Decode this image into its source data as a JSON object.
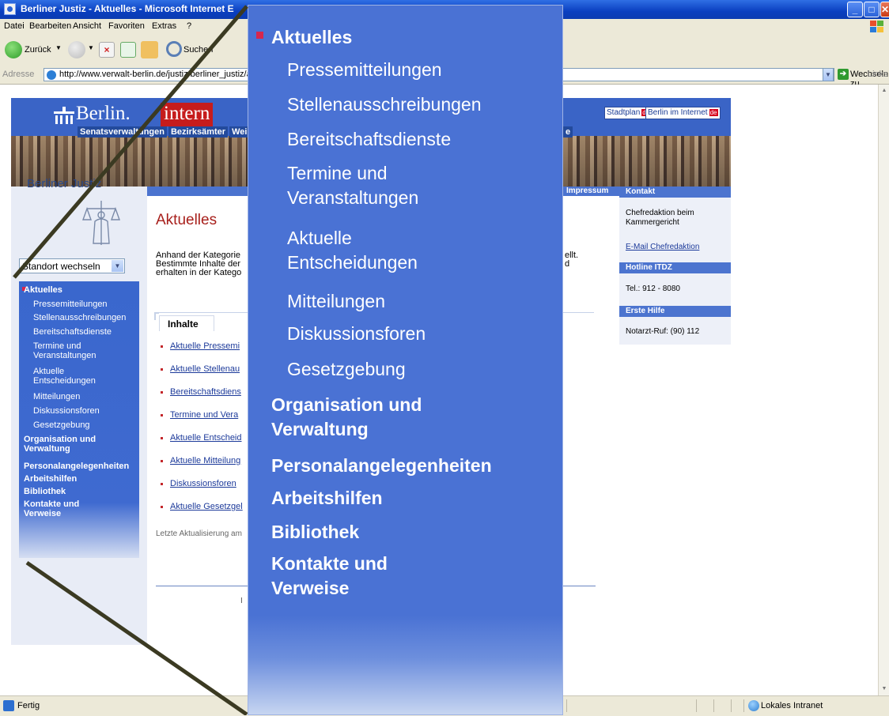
{
  "window": {
    "title": "Berliner Justiz - Aktuelles - Microsoft Internet E"
  },
  "menu": {
    "items": [
      "Datei",
      "Bearbeiten",
      "Ansicht",
      "Favoriten",
      "Extras",
      "?"
    ]
  },
  "toolbar": {
    "back_label": "Zurück",
    "search_label": "Suchen"
  },
  "address": {
    "label": "Adresse",
    "url": "http://www.verwalt-berlin.de/justiz/berliner_justiz/a",
    "go_label": "Wechseln zu",
    "links_label": "Links"
  },
  "header": {
    "logo_part1": "Berlin.",
    "logo_part2": "intern",
    "nav_items": [
      "Senatsverwaltungen",
      "Bezirksämter",
      "Wei"
    ],
    "nav_tail": "e",
    "stadtplan_label": "Stadtplan",
    "berlin_internet_label": "Berlin im Internet",
    "de_badge": "de"
  },
  "sidebar": {
    "section_title": "Berliner Justiz",
    "standort_label": "Standort wechseln",
    "items": [
      {
        "label": "Aktuelles",
        "level": "top",
        "active": true
      },
      {
        "label": "Pressemitteilungen",
        "level": "sub"
      },
      {
        "label": "Stellenausschreibungen",
        "level": "sub"
      },
      {
        "label": "Bereitschaftsdienste",
        "level": "sub"
      },
      {
        "label": "Termine und\nVeranstaltungen",
        "level": "sub"
      },
      {
        "label": "Aktuelle\nEntscheidungen",
        "level": "sub"
      },
      {
        "label": "Mitteilungen",
        "level": "sub"
      },
      {
        "label": "Diskussionsforen",
        "level": "sub"
      },
      {
        "label": "Gesetzgebung",
        "level": "sub"
      },
      {
        "label": "Organisation und\nVerwaltung",
        "level": "top"
      },
      {
        "label": "Personalangelegenheiten",
        "level": "top"
      },
      {
        "label": "Arbeitshilfen",
        "level": "top"
      },
      {
        "label": "Bibliothek",
        "level": "top"
      },
      {
        "label": "Kontakte und\nVerweise",
        "level": "top"
      }
    ]
  },
  "main": {
    "heading": "Aktuelles",
    "intro_lines": "Anhand der Kategorie\nBestimmte Inhalte der\nerhalten in der Katego",
    "intro_tail": "ellt.\nd",
    "tab_label": "Inhalte",
    "links": [
      "Aktuelle Pressemi",
      "Aktuelle Stellenau",
      "Bereitschaftsdiens",
      "Termine und Vera",
      "Aktuelle Entscheid",
      "Aktuelle Mitteilung",
      "Diskussionsforen",
      "Aktuelle Gesetzgel"
    ],
    "last_update": "Letzte Aktualisierung am",
    "footer_cut": "I"
  },
  "top_strip": {
    "impressum": "Impressum"
  },
  "right_column": {
    "kontakt_head": "Kontakt",
    "kontakt_text": "Chefredaktion beim\nKammergericht",
    "email_link": "E-Mail Chefredaktion",
    "hotline_head": "Hotline ITDZ",
    "hotline_text": "Tel.: 912 - 8080",
    "erste_hilfe_head": "Erste Hilfe",
    "erste_hilfe_text": "Notarzt-Ruf: (90) 112"
  },
  "status": {
    "text": "Fertig",
    "zone": "Lokales Intranet"
  },
  "colors": {
    "nav_blue": "#3f6ad0",
    "title_red": "#a8201c",
    "bullet_red": "#d6274e",
    "link_blue": "#1c3a9a"
  }
}
